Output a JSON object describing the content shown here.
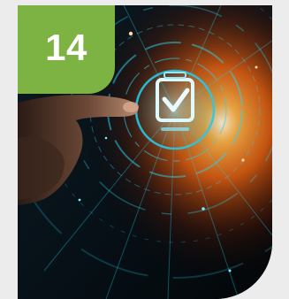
{
  "badge": {
    "number": "14",
    "color": "#7cb342"
  },
  "card": {
    "background_color": "#ececec",
    "glow_color": "#ff6a10",
    "hologram_color": "#29d3f2"
  },
  "image": {
    "subject": "finger-touching-holographic-checkbox",
    "icons": [
      "checkbox-check-icon"
    ]
  }
}
